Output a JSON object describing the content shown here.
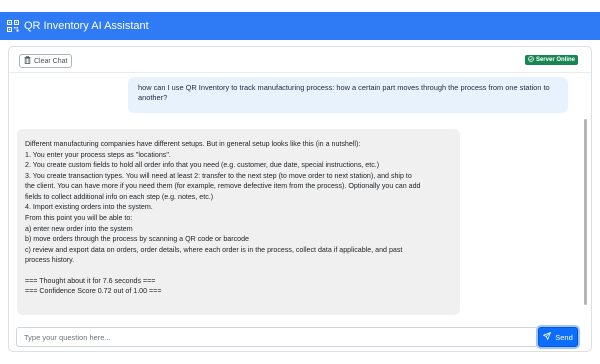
{
  "header": {
    "title": "QR Inventory AI Assistant",
    "icon": "qr-code-icon"
  },
  "toolbar": {
    "clear_label": "Clear Chat",
    "clear_icon": "trash-icon"
  },
  "status": {
    "label": "Server Online",
    "icon": "check-circle-icon",
    "color": "#198754"
  },
  "chat": {
    "user_message": {
      "line1": "how can I use QR Inventory to track manufacturing process: how a certain part moves through the process from one station to",
      "line2": "another?"
    },
    "bot_message": {
      "lines": [
        "Different manufacturing companies have different setups. But in general setup looks like this (in a nutshell):",
        "1. You enter your process steps as \"locations\".",
        "2. You create custom fields to hold all order info that you need (e.g. customer, due date, special instructions, etc.)",
        "3. You create transaction types. You will need at least 2: transfer to the next step (to move order to next station), and ship to",
        "the client. You can have more if you need them (for example, remove defective item from the process). Optionally you can add",
        "fields to collect additional info on each step (e.g. notes, etc.)",
        "4. Import existing orders into the system.",
        "From this point you will be able to:",
        "a) enter new order into the system",
        "b) move orders through the process by scanning a QR code or barcode",
        "c) review and export data on orders, order details, where each order is in the process, collect data if applicable, and past",
        "process history."
      ],
      "thought": "=== Thought about it for 7.6 seconds ===",
      "confidence": "=== Confidence Score 0.72 out of 1.00 ==="
    }
  },
  "input": {
    "placeholder": "Type your question here...",
    "send_label": "Send",
    "send_icon": "send-icon"
  },
  "colors": {
    "accent": "#2f7bf5",
    "button": "#0d6efd",
    "user_bubble": "#e8f2fd",
    "bot_bubble": "#f0f0f0"
  }
}
